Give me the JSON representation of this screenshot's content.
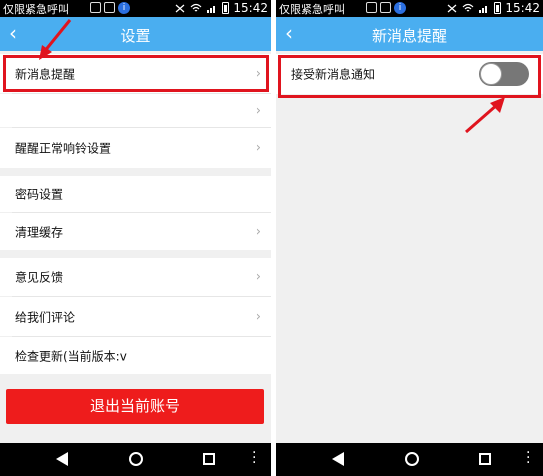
{
  "status_bar": {
    "carrier": "仅限紧急呼叫",
    "info_badge": "i",
    "time": "15:42"
  },
  "left_screen": {
    "title": "设置",
    "rows": [
      {
        "label": "新消息提醒",
        "chevron": "›"
      },
      {
        "label": "",
        "chevron": "›"
      },
      {
        "label": "醒醒正常响铃设置",
        "chevron": "›"
      },
      {
        "label": "密码设置",
        "chevron": ""
      },
      {
        "label": "清理缓存",
        "chevron": "›"
      },
      {
        "label": "意见反馈",
        "chevron": "›"
      },
      {
        "label": "给我们评论",
        "chevron": "›"
      },
      {
        "label": "检查更新(当前版本:v",
        "chevron": ""
      }
    ],
    "logout_label": "退出当前账号"
  },
  "right_screen": {
    "title": "新消息提醒",
    "toggle_label": "接受新消息通知",
    "toggle_on": false
  },
  "colors": {
    "accent": "#4aaef0",
    "highlight": "#e0141e",
    "logout": "#ee1c1c"
  },
  "icons": {
    "back": "chevron-left-icon",
    "chevron": "chevron-right-icon",
    "nav": [
      "nav-back-icon",
      "nav-home-icon",
      "nav-recent-icon",
      "nav-more-icon"
    ]
  }
}
